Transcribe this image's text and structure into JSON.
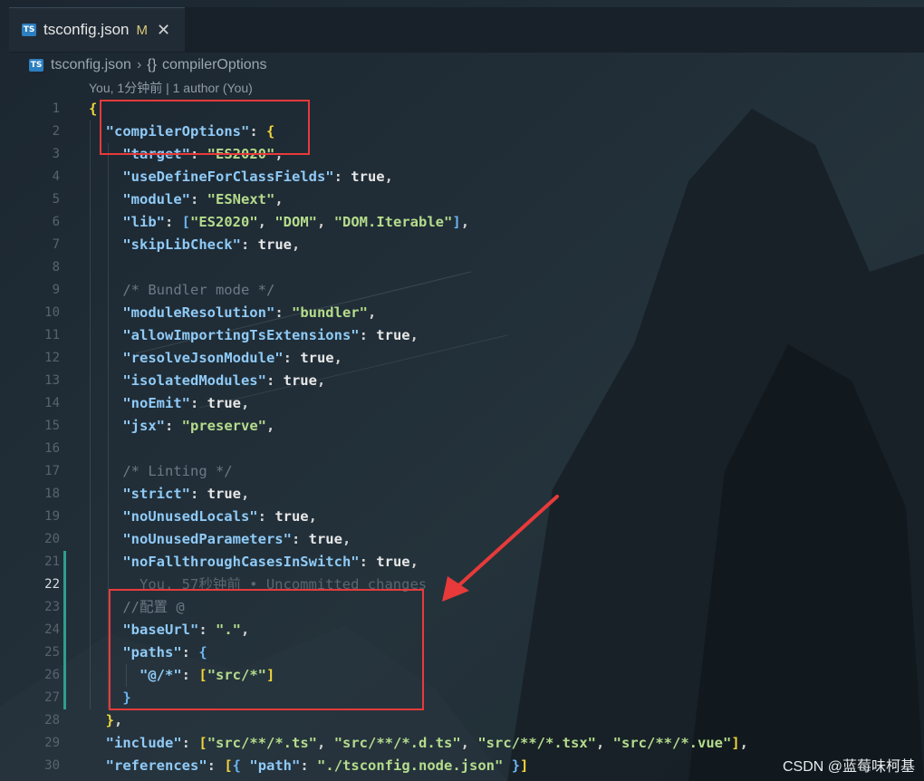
{
  "tab": {
    "name": "tsconfig.json",
    "status": "M",
    "close": "✕",
    "icon_text": "TS"
  },
  "breadcrumb": {
    "file": "tsconfig.json",
    "symbol_icon": "{}",
    "symbol": "compilerOptions"
  },
  "codelens": "You, 1分钟前 | 1 author (You)",
  "line_numbers": [
    "1",
    "2",
    "3",
    "4",
    "5",
    "6",
    "7",
    "8",
    "9",
    "10",
    "11",
    "12",
    "13",
    "14",
    "15",
    "16",
    "17",
    "18",
    "19",
    "20",
    "21",
    "22",
    "23",
    "24",
    "25",
    "26",
    "27",
    "28",
    "29",
    "30"
  ],
  "active_line": "22",
  "watermark": "CSDN @蓝莓味柯基",
  "colors": {
    "accent_red": "#e83a3a",
    "keyword": "#8fcaf7",
    "string": "#b5dc8c",
    "brace": "#f0d43a"
  },
  "code_lines": [
    [
      [
        "b",
        "{"
      ]
    ],
    [
      [
        "p",
        "  "
      ],
      [
        "k",
        "\"compilerOptions\""
      ],
      [
        "p",
        ": "
      ],
      [
        "b",
        "{"
      ]
    ],
    [
      [
        "p",
        "    "
      ],
      [
        "k",
        "\"target\""
      ],
      [
        "p",
        ": "
      ],
      [
        "s",
        "\"ES2020\""
      ],
      [
        "p",
        ","
      ]
    ],
    [
      [
        "p",
        "    "
      ],
      [
        "k",
        "\"useDefineForClassFields\""
      ],
      [
        "p",
        ": "
      ],
      [
        "t",
        "true"
      ],
      [
        "p",
        ","
      ]
    ],
    [
      [
        "p",
        "    "
      ],
      [
        "k",
        "\"module\""
      ],
      [
        "p",
        ": "
      ],
      [
        "s",
        "\"ESNext\""
      ],
      [
        "p",
        ","
      ]
    ],
    [
      [
        "p",
        "    "
      ],
      [
        "k",
        "\"lib\""
      ],
      [
        "p",
        ": "
      ],
      [
        "bl",
        "["
      ],
      [
        "s",
        "\"ES2020\""
      ],
      [
        "p",
        ", "
      ],
      [
        "s",
        "\"DOM\""
      ],
      [
        "p",
        ", "
      ],
      [
        "s",
        "\"DOM.Iterable\""
      ],
      [
        "bl",
        "]"
      ],
      [
        "p",
        ","
      ]
    ],
    [
      [
        "p",
        "    "
      ],
      [
        "k",
        "\"skipLibCheck\""
      ],
      [
        "p",
        ": "
      ],
      [
        "t",
        "true"
      ],
      [
        "p",
        ","
      ]
    ],
    [
      [
        "p",
        ""
      ]
    ],
    [
      [
        "p",
        "    "
      ],
      [
        "c",
        "/* Bundler mode */"
      ]
    ],
    [
      [
        "p",
        "    "
      ],
      [
        "k",
        "\"moduleResolution\""
      ],
      [
        "p",
        ": "
      ],
      [
        "s",
        "\"bundler\""
      ],
      [
        "p",
        ","
      ]
    ],
    [
      [
        "p",
        "    "
      ],
      [
        "k",
        "\"allowImportingTsExtensions\""
      ],
      [
        "p",
        ": "
      ],
      [
        "t",
        "true"
      ],
      [
        "p",
        ","
      ]
    ],
    [
      [
        "p",
        "    "
      ],
      [
        "k",
        "\"resolveJsonModule\""
      ],
      [
        "p",
        ": "
      ],
      [
        "t",
        "true"
      ],
      [
        "p",
        ","
      ]
    ],
    [
      [
        "p",
        "    "
      ],
      [
        "k",
        "\"isolatedModules\""
      ],
      [
        "p",
        ": "
      ],
      [
        "t",
        "true"
      ],
      [
        "p",
        ","
      ]
    ],
    [
      [
        "p",
        "    "
      ],
      [
        "k",
        "\"noEmit\""
      ],
      [
        "p",
        ": "
      ],
      [
        "t",
        "true"
      ],
      [
        "p",
        ","
      ]
    ],
    [
      [
        "p",
        "    "
      ],
      [
        "k",
        "\"jsx\""
      ],
      [
        "p",
        ": "
      ],
      [
        "s",
        "\"preserve\""
      ],
      [
        "p",
        ","
      ]
    ],
    [
      [
        "p",
        ""
      ]
    ],
    [
      [
        "p",
        "    "
      ],
      [
        "c",
        "/* Linting */"
      ]
    ],
    [
      [
        "p",
        "    "
      ],
      [
        "k",
        "\"strict\""
      ],
      [
        "p",
        ": "
      ],
      [
        "t",
        "true"
      ],
      [
        "p",
        ","
      ]
    ],
    [
      [
        "p",
        "    "
      ],
      [
        "k",
        "\"noUnusedLocals\""
      ],
      [
        "p",
        ": "
      ],
      [
        "t",
        "true"
      ],
      [
        "p",
        ","
      ]
    ],
    [
      [
        "p",
        "    "
      ],
      [
        "k",
        "\"noUnusedParameters\""
      ],
      [
        "p",
        ": "
      ],
      [
        "t",
        "true"
      ],
      [
        "p",
        ","
      ]
    ],
    [
      [
        "p",
        "    "
      ],
      [
        "k",
        "\"noFallthroughCasesInSwitch\""
      ],
      [
        "p",
        ": "
      ],
      [
        "t",
        "true"
      ],
      [
        "p",
        ","
      ]
    ],
    [
      [
        "p",
        "      "
      ],
      [
        "ghost",
        "You, 57秒钟前 • Uncommitted changes"
      ]
    ],
    [
      [
        "p",
        "    "
      ],
      [
        "c",
        "//配置 @"
      ]
    ],
    [
      [
        "p",
        "    "
      ],
      [
        "k",
        "\"baseUrl\""
      ],
      [
        "p",
        ": "
      ],
      [
        "s",
        "\".\""
      ],
      [
        "p",
        ","
      ]
    ],
    [
      [
        "p",
        "    "
      ],
      [
        "k",
        "\"paths\""
      ],
      [
        "p",
        ": "
      ],
      [
        "bl",
        "{"
      ]
    ],
    [
      [
        "p",
        "      "
      ],
      [
        "k",
        "\"@/*\""
      ],
      [
        "p",
        ": "
      ],
      [
        "b",
        "["
      ],
      [
        "s",
        "\"src/*\""
      ],
      [
        "b",
        "]"
      ]
    ],
    [
      [
        "p",
        "    "
      ],
      [
        "bl",
        "}"
      ]
    ],
    [
      [
        "p",
        "  "
      ],
      [
        "b",
        "}"
      ],
      [
        "p",
        ","
      ]
    ],
    [
      [
        "p",
        "  "
      ],
      [
        "k",
        "\"include\""
      ],
      [
        "p",
        ": "
      ],
      [
        "b",
        "["
      ],
      [
        "s",
        "\"src/**/*.ts\""
      ],
      [
        "p",
        ", "
      ],
      [
        "s",
        "\"src/**/*.d.ts\""
      ],
      [
        "p",
        ", "
      ],
      [
        "s",
        "\"src/**/*.tsx\""
      ],
      [
        "p",
        ", "
      ],
      [
        "s",
        "\"src/**/*.vue\""
      ],
      [
        "b",
        "]"
      ],
      [
        "p",
        ","
      ]
    ],
    [
      [
        "p",
        "  "
      ],
      [
        "k",
        "\"references\""
      ],
      [
        "p",
        ": "
      ],
      [
        "b",
        "["
      ],
      [
        "bl",
        "{"
      ],
      [
        "p",
        " "
      ],
      [
        "k",
        "\"path\""
      ],
      [
        "p",
        ": "
      ],
      [
        "s",
        "\"./tsconfig.node.json\""
      ],
      [
        "p",
        " "
      ],
      [
        "bl",
        "}"
      ],
      [
        "b",
        "]"
      ]
    ]
  ]
}
